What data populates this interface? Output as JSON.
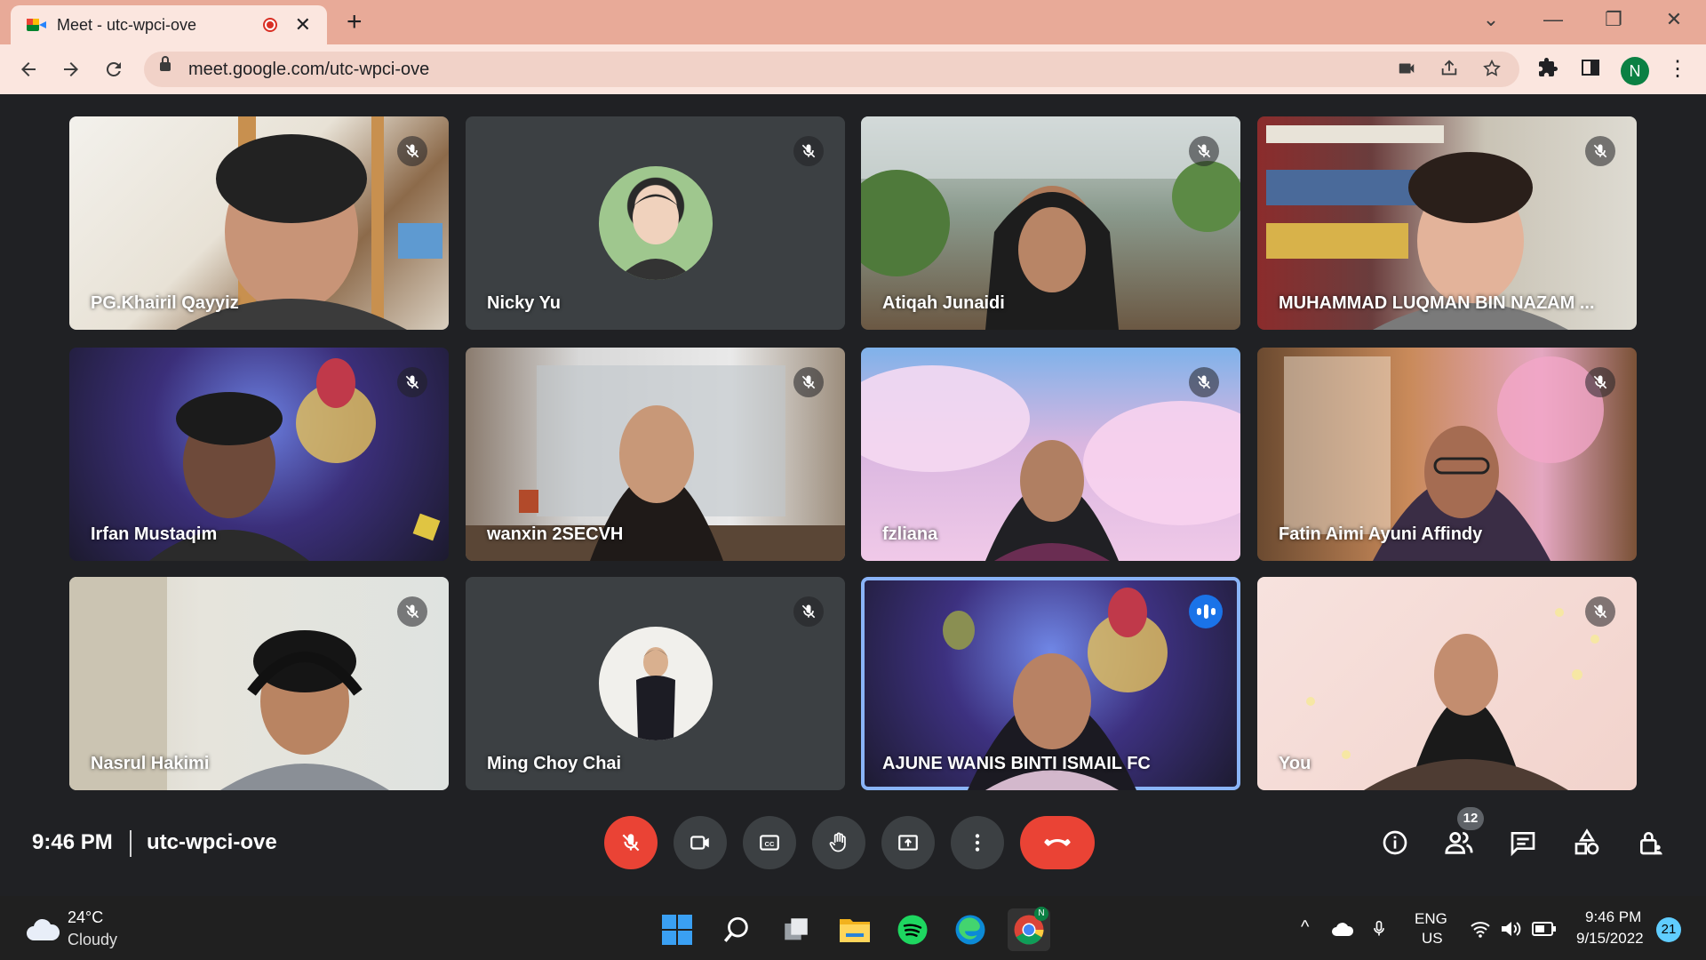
{
  "browser": {
    "tab_title": "Meet - utc-wpci-ove",
    "url": "meet.google.com/utc-wpci-ove",
    "profile_initial": "N"
  },
  "participants": [
    {
      "name": "PG.Khairil Qayyiz",
      "muted": true,
      "type": "video"
    },
    {
      "name": "Nicky Yu",
      "muted": true,
      "type": "avatar"
    },
    {
      "name": "Atiqah Junaidi",
      "muted": true,
      "type": "video"
    },
    {
      "name": "MUHAMMAD LUQMAN BIN NAZAM ...",
      "muted": true,
      "type": "video"
    },
    {
      "name": "Irfan Mustaqim",
      "muted": true,
      "type": "video"
    },
    {
      "name": "wanxin 2SECVH",
      "muted": true,
      "type": "video"
    },
    {
      "name": "fzliana",
      "muted": true,
      "type": "video"
    },
    {
      "name": "Fatin Aimi Ayuni Affindy",
      "muted": true,
      "type": "video"
    },
    {
      "name": "Nasrul Hakimi",
      "muted": true,
      "type": "video"
    },
    {
      "name": "Ming Choy Chai",
      "muted": true,
      "type": "avatar"
    },
    {
      "name": "AJUNE WANIS BINTI ISMAIL FC",
      "muted": false,
      "speaking": true,
      "type": "video"
    },
    {
      "name": "You",
      "muted": true,
      "type": "video"
    }
  ],
  "meeting": {
    "time": "9:46 PM",
    "code": "utc-wpci-ove",
    "people_count": "12"
  },
  "taskbar": {
    "weather_temp": "24°C",
    "weather_desc": "Cloudy",
    "lang_top": "ENG",
    "lang_bottom": "US",
    "clock_time": "9:46 PM",
    "clock_date": "9/15/2022",
    "notifications": "21"
  },
  "colors": {
    "titlebar": "#e8aa98",
    "toolbar": "#fbe6df",
    "meet_bg": "#202124",
    "tile_bg": "#3c4043",
    "mic_off_red": "#ea4335",
    "speaking_blue": "#1a73e8"
  }
}
